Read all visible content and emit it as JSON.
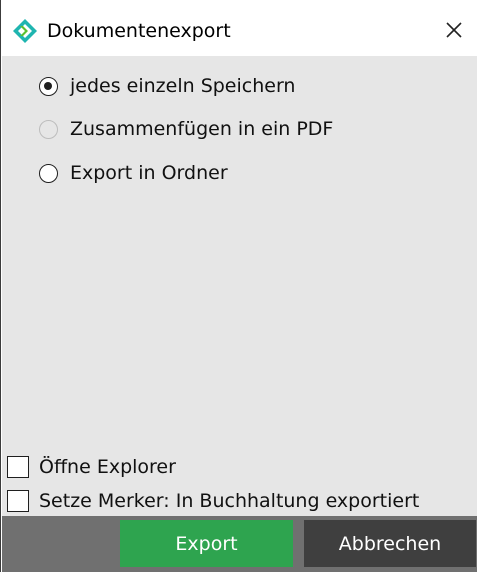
{
  "window": {
    "title": "Dokumentenexport",
    "app_icon": "diamond-chevron-logo-icon",
    "close_icon": "close-icon"
  },
  "options": [
    {
      "label": "jedes einzeln Speichern",
      "checked": true,
      "disabled": false
    },
    {
      "label": "Zusammenfügen in ein PDF",
      "checked": false,
      "disabled": true
    },
    {
      "label": "Export in Ordner",
      "checked": false,
      "disabled": false
    }
  ],
  "checkboxes": [
    {
      "label": "Öffne Explorer",
      "checked": false
    },
    {
      "label": "Setze Merker: In Buchhaltung exportiert",
      "checked": false
    }
  ],
  "buttons": {
    "export_label": "Export",
    "cancel_label": "Abbrechen"
  },
  "colors": {
    "content_bg": "#e6e6e6",
    "footer_bg": "#707070",
    "export_bg": "#2ea44f",
    "cancel_bg": "#3f3f3f",
    "logo_teal": "#1fb5b0",
    "logo_green": "#5bbf2f"
  }
}
